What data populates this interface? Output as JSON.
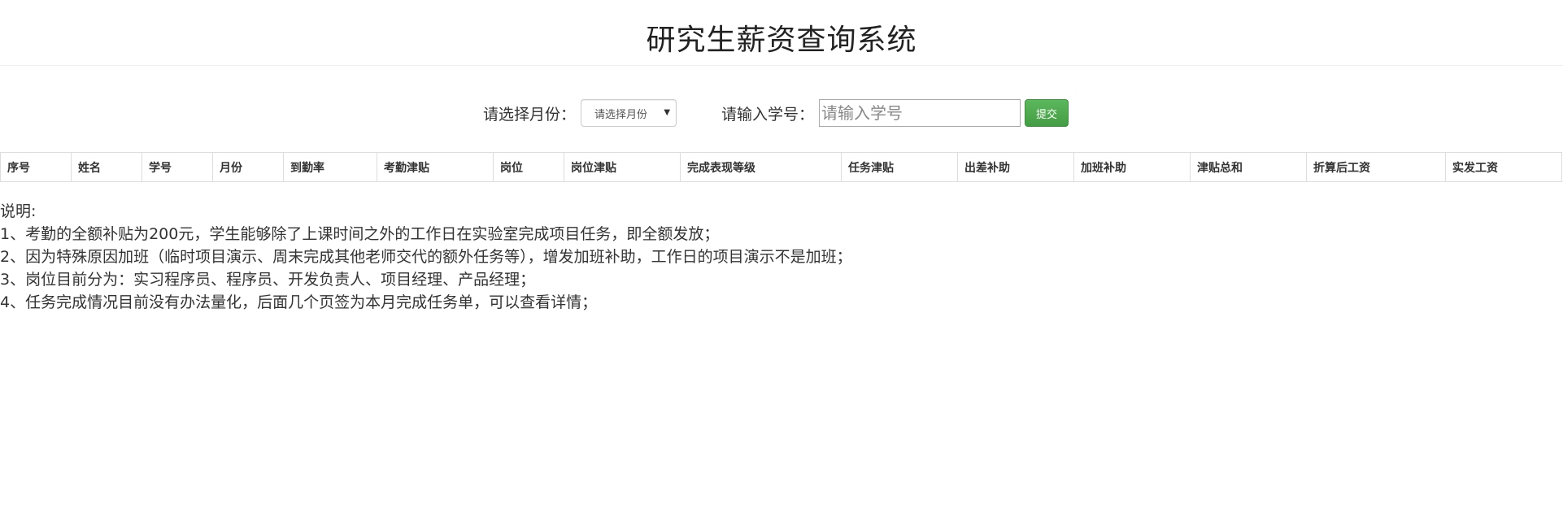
{
  "header": {
    "title": "研究生薪资查询系统"
  },
  "form": {
    "month_label": "请选择月份：",
    "month_select_value": "请选择月份",
    "student_id_label": "请输入学号：",
    "student_id_placeholder": "请输入学号",
    "student_id_value": "",
    "submit_label": "提交"
  },
  "table": {
    "columns": [
      "序号",
      "姓名",
      "学号",
      "月份",
      "到勤率",
      "考勤津贴",
      "岗位",
      "岗位津贴",
      "完成表现等级",
      "任务津贴",
      "出差补助",
      "加班补助",
      "津贴总和",
      "折算后工资",
      "实发工资"
    ],
    "rows": []
  },
  "notes": {
    "heading": "说明:",
    "items": [
      "1、考勤的全额补贴为200元，学生能够除了上课时间之外的工作日在实验室完成项目任务，即全额发放；",
      "2、因为特殊原因加班（临时项目演示、周末完成其他老师交代的额外任务等），增发加班补助，工作日的项目演示不是加班；",
      "3、岗位目前分为：实习程序员、程序员、开发负责人、项目经理、产品经理；",
      "4、任务完成情况目前没有办法量化，后面几个页签为本月完成任务单，可以查看详情；"
    ]
  },
  "colors": {
    "submit_button": "#5cb85c",
    "border": "#dddddd",
    "text": "#333333"
  }
}
